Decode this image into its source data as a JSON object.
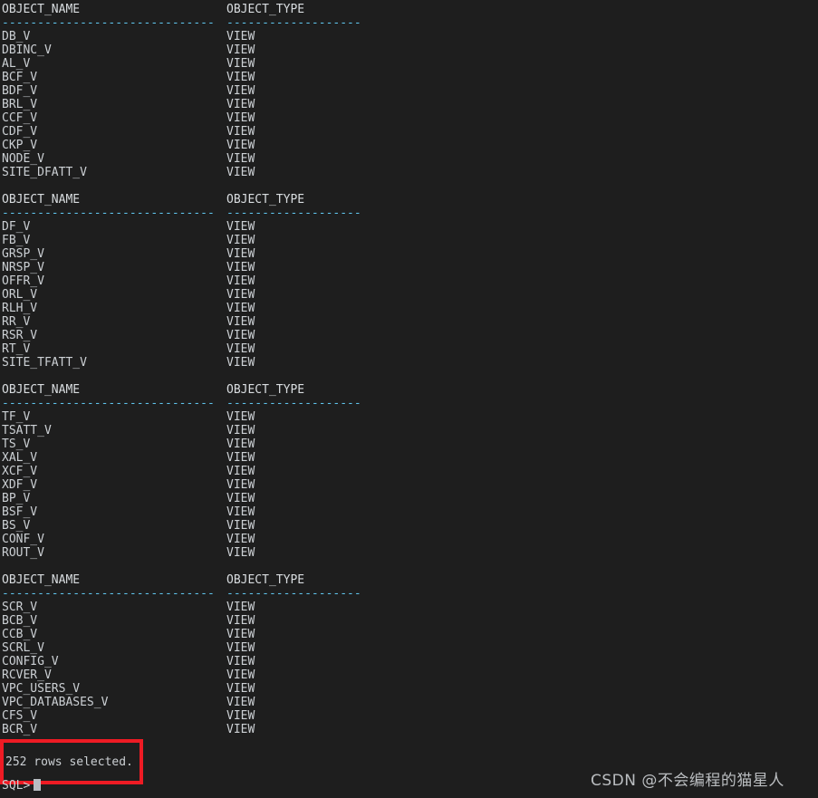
{
  "terminal": {
    "app": "sqlplus-console",
    "background_color": "#1e1e1e",
    "text_color": "#ccd0d4",
    "rule_color": "#5fc3ea",
    "columns": {
      "name_header": "OBJECT_NAME",
      "type_header": "OBJECT_TYPE",
      "name_rule": "------------------------------",
      "type_rule": "-------------------"
    },
    "blocks": [
      {
        "rows": [
          {
            "name": "DB_V",
            "type": "VIEW"
          },
          {
            "name": "DBINC_V",
            "type": "VIEW"
          },
          {
            "name": "AL_V",
            "type": "VIEW"
          },
          {
            "name": "BCF_V",
            "type": "VIEW"
          },
          {
            "name": "BDF_V",
            "type": "VIEW"
          },
          {
            "name": "BRL_V",
            "type": "VIEW"
          },
          {
            "name": "CCF_V",
            "type": "VIEW"
          },
          {
            "name": "CDF_V",
            "type": "VIEW"
          },
          {
            "name": "CKP_V",
            "type": "VIEW"
          },
          {
            "name": "NODE_V",
            "type": "VIEW"
          },
          {
            "name": "SITE_DFATT_V",
            "type": "VIEW"
          }
        ]
      },
      {
        "rows": [
          {
            "name": "DF_V",
            "type": "VIEW"
          },
          {
            "name": "FB_V",
            "type": "VIEW"
          },
          {
            "name": "GRSP_V",
            "type": "VIEW"
          },
          {
            "name": "NRSP_V",
            "type": "VIEW"
          },
          {
            "name": "OFFR_V",
            "type": "VIEW"
          },
          {
            "name": "ORL_V",
            "type": "VIEW"
          },
          {
            "name": "RLH_V",
            "type": "VIEW"
          },
          {
            "name": "RR_V",
            "type": "VIEW"
          },
          {
            "name": "RSR_V",
            "type": "VIEW"
          },
          {
            "name": "RT_V",
            "type": "VIEW"
          },
          {
            "name": "SITE_TFATT_V",
            "type": "VIEW"
          }
        ]
      },
      {
        "rows": [
          {
            "name": "TF_V",
            "type": "VIEW"
          },
          {
            "name": "TSATT_V",
            "type": "VIEW"
          },
          {
            "name": "TS_V",
            "type": "VIEW"
          },
          {
            "name": "XAL_V",
            "type": "VIEW"
          },
          {
            "name": "XCF_V",
            "type": "VIEW"
          },
          {
            "name": "XDF_V",
            "type": "VIEW"
          },
          {
            "name": "BP_V",
            "type": "VIEW"
          },
          {
            "name": "BSF_V",
            "type": "VIEW"
          },
          {
            "name": "BS_V",
            "type": "VIEW"
          },
          {
            "name": "CONF_V",
            "type": "VIEW"
          },
          {
            "name": "ROUT_V",
            "type": "VIEW"
          }
        ]
      },
      {
        "rows": [
          {
            "name": "SCR_V",
            "type": "VIEW"
          },
          {
            "name": "BCB_V",
            "type": "VIEW"
          },
          {
            "name": "CCB_V",
            "type": "VIEW"
          },
          {
            "name": "SCRL_V",
            "type": "VIEW"
          },
          {
            "name": "CONFIG_V",
            "type": "VIEW"
          },
          {
            "name": "RCVER_V",
            "type": "VIEW"
          },
          {
            "name": "VPC_USERS_V",
            "type": "VIEW"
          },
          {
            "name": "VPC_DATABASES_V",
            "type": "VIEW"
          },
          {
            "name": "CFS_V",
            "type": "VIEW"
          },
          {
            "name": "BCR_V",
            "type": "VIEW"
          }
        ]
      }
    ],
    "status": {
      "text": "252 rows selected.",
      "highlight_color": "#ee1b24"
    },
    "prompt": {
      "text": "SQL>"
    }
  },
  "watermark": {
    "text": "CSDN @不会编程的猫星人"
  }
}
